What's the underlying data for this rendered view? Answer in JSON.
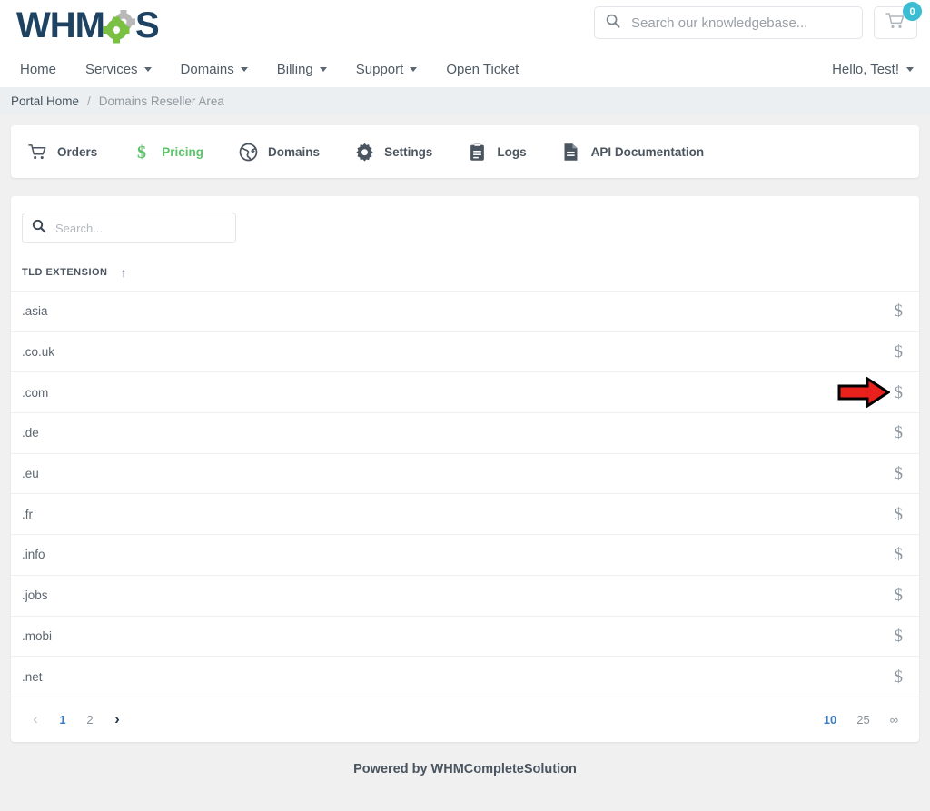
{
  "brand": {
    "logo_text_left": "WHM",
    "logo_text_right": "S",
    "accent_green": "#7ac143",
    "logo_navy": "#1d4262",
    "badge_teal": "#3bbcd3"
  },
  "header": {
    "search_placeholder": "Search our knowledgebase...",
    "search_value": "",
    "search_icon": "search-icon",
    "cart_icon": "shopping-cart-icon",
    "cart_count": "0"
  },
  "nav": {
    "items": [
      {
        "label": "Home",
        "has_caret": false
      },
      {
        "label": "Services",
        "has_caret": true
      },
      {
        "label": "Domains",
        "has_caret": true
      },
      {
        "label": "Billing",
        "has_caret": true
      },
      {
        "label": "Support",
        "has_caret": true
      },
      {
        "label": "Open Ticket",
        "has_caret": false
      }
    ],
    "account_label": "Hello, Test!"
  },
  "breadcrumb": {
    "home": "Portal Home",
    "separator": "/",
    "current": "Domains Reseller Area"
  },
  "tabs": [
    {
      "label": "Orders",
      "icon": "shopping-cart-icon",
      "active": false
    },
    {
      "label": "Pricing",
      "icon": "dollar-sign-icon",
      "active": true
    },
    {
      "label": "Domains",
      "icon": "globe-icon",
      "active": false
    },
    {
      "label": "Settings",
      "icon": "gear-icon",
      "active": false
    },
    {
      "label": "Logs",
      "icon": "clipboard-icon",
      "active": false
    },
    {
      "label": "API Documentation",
      "icon": "file-document-icon",
      "active": false
    }
  ],
  "table": {
    "search_placeholder": "Search...",
    "search_value": "",
    "search_icon": "search-icon",
    "column_header": "TLD EXTENSION",
    "sort_direction_icon": "↑",
    "action_icon": "dollar-sign-icon",
    "rows": [
      {
        "tld": ".asia",
        "annotated": false
      },
      {
        "tld": ".co.uk",
        "annotated": false
      },
      {
        "tld": ".com",
        "annotated": true
      },
      {
        "tld": ".de",
        "annotated": false
      },
      {
        "tld": ".eu",
        "annotated": false
      },
      {
        "tld": ".fr",
        "annotated": false
      },
      {
        "tld": ".info",
        "annotated": false
      },
      {
        "tld": ".jobs",
        "annotated": false
      },
      {
        "tld": ".mobi",
        "annotated": false
      },
      {
        "tld": ".net",
        "annotated": false
      }
    ]
  },
  "pagination": {
    "prev_icon": "chevron-left-icon",
    "next_icon": "chevron-right-icon",
    "pages": [
      {
        "label": "1",
        "active": true
      },
      {
        "label": "2",
        "active": false
      }
    ],
    "per_page": [
      {
        "label": "10",
        "active": true
      },
      {
        "label": "25",
        "active": false
      },
      {
        "label": "∞",
        "active": false
      }
    ]
  },
  "annotation": {
    "arrow_color": "#e8211c",
    "arrow_outline": "#000000",
    "points_to": ".com row pricing action"
  },
  "footer": {
    "text": "Powered by WHMCompleteSolution"
  }
}
